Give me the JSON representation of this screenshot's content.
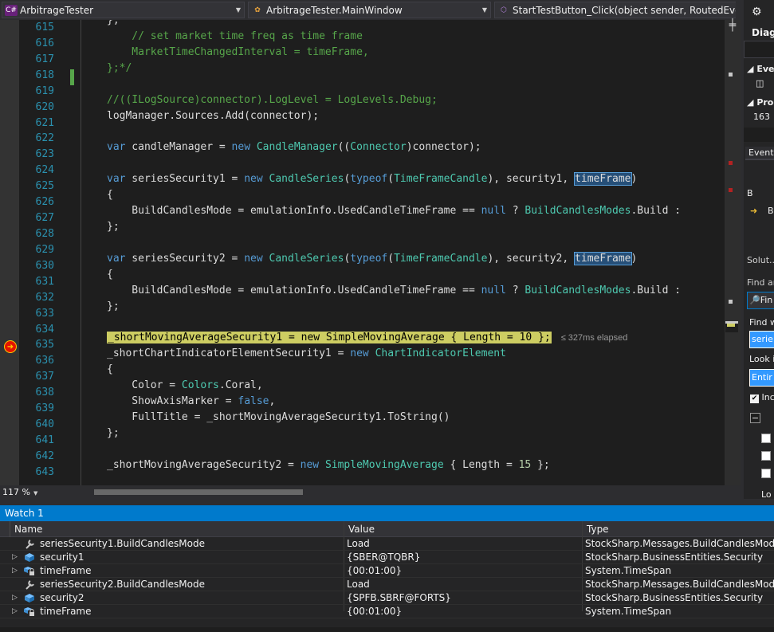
{
  "navbar": {
    "project": "ArbitrageTester",
    "project_icon": "C#",
    "type": "ArbitrageTester.MainWindow",
    "member": "StartTestButton_Click(object sender, RoutedEventA"
  },
  "editor": {
    "line_numbers": [
      "615",
      "616",
      "617",
      "618",
      "619",
      "620",
      "621",
      "622",
      "623",
      "624",
      "625",
      "626",
      "627",
      "628",
      "629",
      "630",
      "631",
      "632",
      "633",
      "634",
      "635",
      "636",
      "637",
      "638",
      "639",
      "640",
      "641",
      "642",
      "643"
    ],
    "elapsed": "≤ 327ms elapsed",
    "zoom": "117 %"
  },
  "code": {
    "l615": "};",
    "l616": "    // set market time freq as time frame",
    "l617": "    MarketTimeChangedInterval = timeFrame,",
    "l618": "};*/",
    "l620": "//((ILogSource)connector).LogLevel = LogLevels.Debug;",
    "l621": "logManager.Sources.Add(connector);",
    "t_var": "var",
    "t_new": "new",
    "t_typeof": "typeof",
    "t_null": "null",
    "t_false": "false",
    "l623_a": " candleManager = ",
    "t_CandleManager": "CandleManager",
    "t_Connector": "Connector",
    "l623_b": "((",
    "l623_c": ")connector);",
    "l625_a": " seriesSecurity1 = ",
    "t_CandleSeries": "CandleSeries",
    "t_TimeFrameCandle": "TimeFrameCandle",
    "l625_b": "), security1, ",
    "t_timeFrame": "timeFrame",
    "paren_open": "(",
    "paren_close": ")",
    "brace_open": "{",
    "brace_close": "};",
    "build_a": "    BuildCandlesMode = emulationInfo.UsedCandleTimeFrame == ",
    "build_b": " ? ",
    "t_BuildCandlesModes": "BuildCandlesModes",
    "build_c": ".Build :",
    "l630_a": " seriesSecurity2 = ",
    "l630_b": "), security2, ",
    "l635": "_shortMovingAverageSecurity1 = new SimpleMovingAverage { Length = 10 };",
    "l636_a": "_shortChartIndicatorElementSecurity1 = ",
    "t_ChartIndicatorElement": "ChartIndicatorElement",
    "l638_a": "    Color = ",
    "t_Colors": "Colors",
    "l638_b": ".Coral,",
    "l639_a": "    ShowAxisMarker = ",
    "l639_b": ",",
    "l640": "    FullTitle = _shortMovingAverageSecurity1.ToString()",
    "l643_a": "_shortMovingAverageSecurity2 = ",
    "t_SimpleMovingAverage": "SimpleMovingAverage",
    "l643_b": " { Length = ",
    "n15": "15",
    "l643_c": " };"
  },
  "right_panel": {
    "diag": "Diagr",
    "events": "Even",
    "proc": "Proc",
    "proc_val": "163",
    "event_tab": "Event",
    "solution": "Solut...",
    "find_and": "Find ar",
    "find_btn": "Fin",
    "find_what": "Find w",
    "find_what_val": "serie",
    "look_in": "Look i",
    "look_in_val": "Entir",
    "include": "Inc",
    "look_at": "Lo"
  },
  "watch": {
    "title": "Watch 1",
    "columns": [
      "Name",
      "Value",
      "Type"
    ],
    "rows": [
      {
        "name": "seriesSecurity1.BuildCandlesMode",
        "value": "Load",
        "type": "StockSharp.Messages.BuildCandlesModes",
        "expand": "",
        "icon": "wrench-icon"
      },
      {
        "name": "security1",
        "value": "{SBER@TQBR}",
        "type": "StockSharp.BusinessEntities.Security",
        "expand": "▷",
        "icon": "cube-icon"
      },
      {
        "name": "timeFrame",
        "value": "{00:01:00}",
        "type": "System.TimeSpan",
        "expand": "▷",
        "icon": "locked-variable-icon"
      },
      {
        "name": "seriesSecurity2.BuildCandlesMode",
        "value": "Load",
        "type": "StockSharp.Messages.BuildCandlesModes",
        "expand": "",
        "icon": "wrench-icon"
      },
      {
        "name": "security2",
        "value": "{SPFB.SBRF@FORTS}",
        "type": "StockSharp.BusinessEntities.Security",
        "expand": "▷",
        "icon": "cube-icon"
      },
      {
        "name": "timeFrame",
        "value": "{00:01:00}",
        "type": "System.TimeSpan",
        "expand": "▷",
        "icon": "locked-variable-icon"
      }
    ]
  },
  "colors": {
    "accent": "#007acc",
    "current_statement": "#cdcd62",
    "breakpoint": "#e51400"
  }
}
